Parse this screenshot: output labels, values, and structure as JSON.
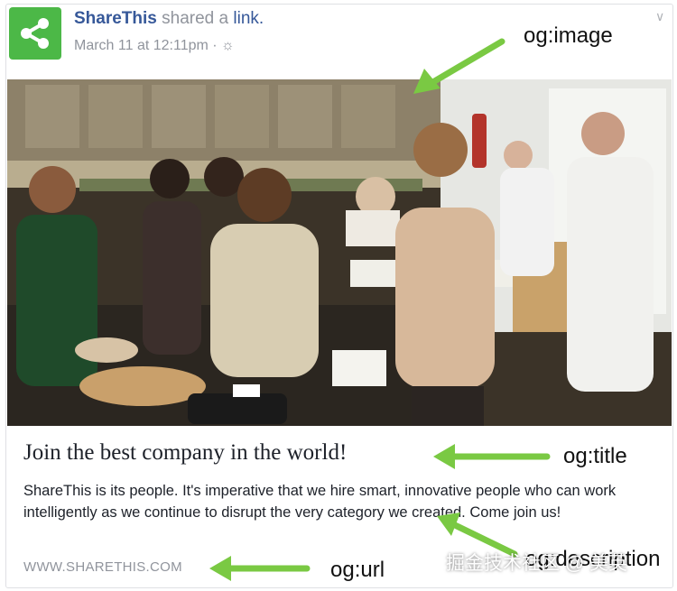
{
  "post": {
    "author": "ShareThis",
    "action_prefix": "shared a",
    "action_link": "link.",
    "timestamp": "March 11 at 12:11pm · ☼",
    "menu_icon": "chevron-down-icon",
    "logo_icon": "share-icon"
  },
  "card": {
    "title": "Join the best company in the world!",
    "description": "ShareThis is its people. It's imperative that we hire smart, innovative people who can work intelligently as we continue to disrupt the very category we created. Come join us!",
    "url": "WWW.SHARETHIS.COM"
  },
  "annotations": {
    "image": "og:image",
    "title": "og:title",
    "description": "og:description",
    "url": "og:url"
  },
  "watermark": "掘金技术社区 @ 美英",
  "colors": {
    "brand_green": "#4cb847",
    "link_blue": "#365899",
    "arrow_green": "#7ac943"
  }
}
